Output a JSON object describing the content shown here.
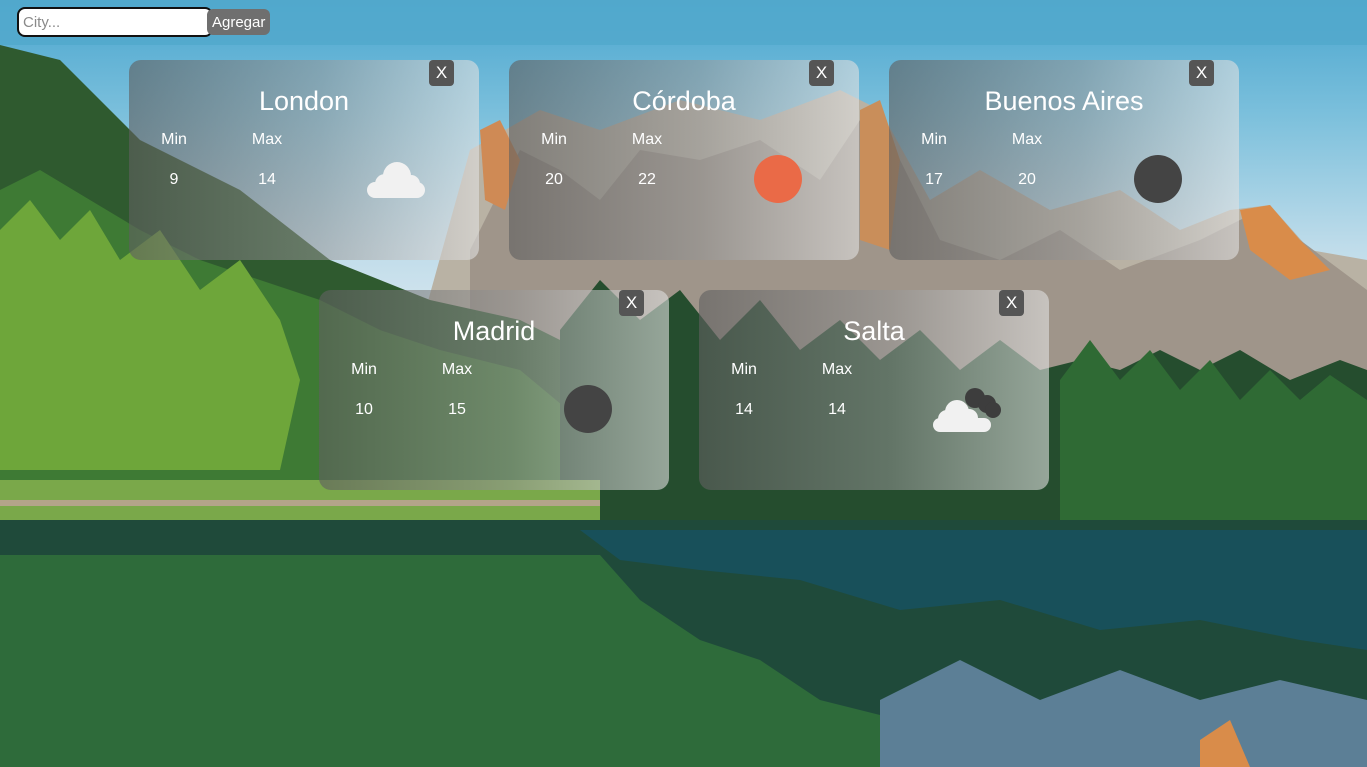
{
  "search": {
    "placeholder": "City...",
    "value": ""
  },
  "add_button_label": "Agregar",
  "labels": {
    "min": "Min",
    "max": "Max"
  },
  "cards": [
    {
      "city": "London",
      "min": "9",
      "max": "14",
      "close_label": "X",
      "icon": "cloud-icon",
      "icon_color": "#f1f1f1"
    },
    {
      "city": "Córdoba",
      "min": "20",
      "max": "22",
      "close_label": "X",
      "icon": "sun-icon",
      "icon_color": "#ea6a47"
    },
    {
      "city": "Buenos Aires",
      "min": "17",
      "max": "20",
      "close_label": "X",
      "icon": "moon-icon",
      "icon_color": "#444444"
    },
    {
      "city": "Madrid",
      "min": "10",
      "max": "15",
      "close_label": "X",
      "icon": "moon-icon",
      "icon_color": "#444444"
    },
    {
      "city": "Salta",
      "min": "14",
      "max": "14",
      "close_label": "X",
      "icon": "clouds-icon",
      "icon_color": "#f1f1f1"
    }
  ]
}
